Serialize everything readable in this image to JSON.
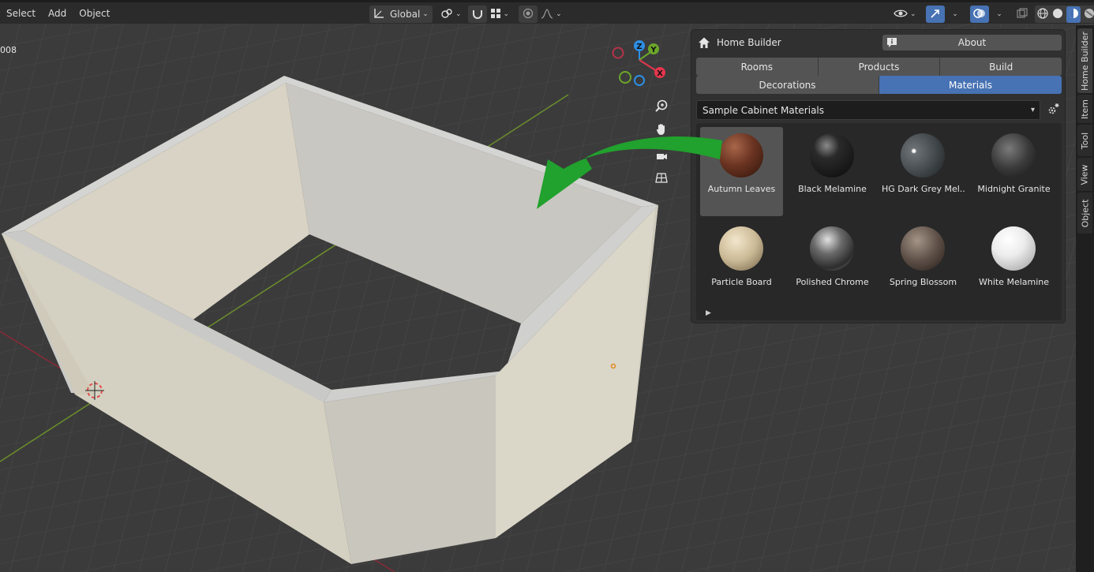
{
  "header": {
    "menus": [
      "Select",
      "Add",
      "Object"
    ],
    "orientation": "Global"
  },
  "viewport": {
    "frame_label": "008",
    "gizmo_axes": [
      "X",
      "Y",
      "Z"
    ]
  },
  "sidebar_tabs": [
    "Home Builder",
    "Item",
    "Tool",
    "View",
    "Object"
  ],
  "panel": {
    "title": "Home Builder",
    "about_label": "About",
    "tabs_row1": [
      "Rooms",
      "Products",
      "Build"
    ],
    "tabs_row2": [
      "Decorations",
      "Materials"
    ],
    "active_tab": "Materials",
    "library_select": "Sample Cabinet Materials",
    "materials": [
      {
        "name": "Autumn Leaves",
        "selected": true,
        "color": "#6b3422"
      },
      {
        "name": "Black Melamine",
        "selected": false,
        "color": "#1a1a1a"
      },
      {
        "name": "HG Dark Grey Mel...",
        "selected": false,
        "color": "#4a4f52"
      },
      {
        "name": "Midnight Granite",
        "selected": false,
        "color": "#3a3a3a"
      },
      {
        "name": "Particle Board",
        "selected": false,
        "color": "#c9b893"
      },
      {
        "name": "Polished Chrome",
        "selected": false,
        "color": "#7a7a7a"
      },
      {
        "name": "Spring Blossom",
        "selected": false,
        "color": "#5e5048"
      },
      {
        "name": "White Melamine",
        "selected": false,
        "color": "#e8e8e8"
      }
    ]
  },
  "colors": {
    "accent": "#4772b3",
    "arrow": "#21a12d",
    "axis_x": "#e4364c",
    "axis_y": "#6ba62a",
    "axis_z": "#2c8fe5"
  }
}
